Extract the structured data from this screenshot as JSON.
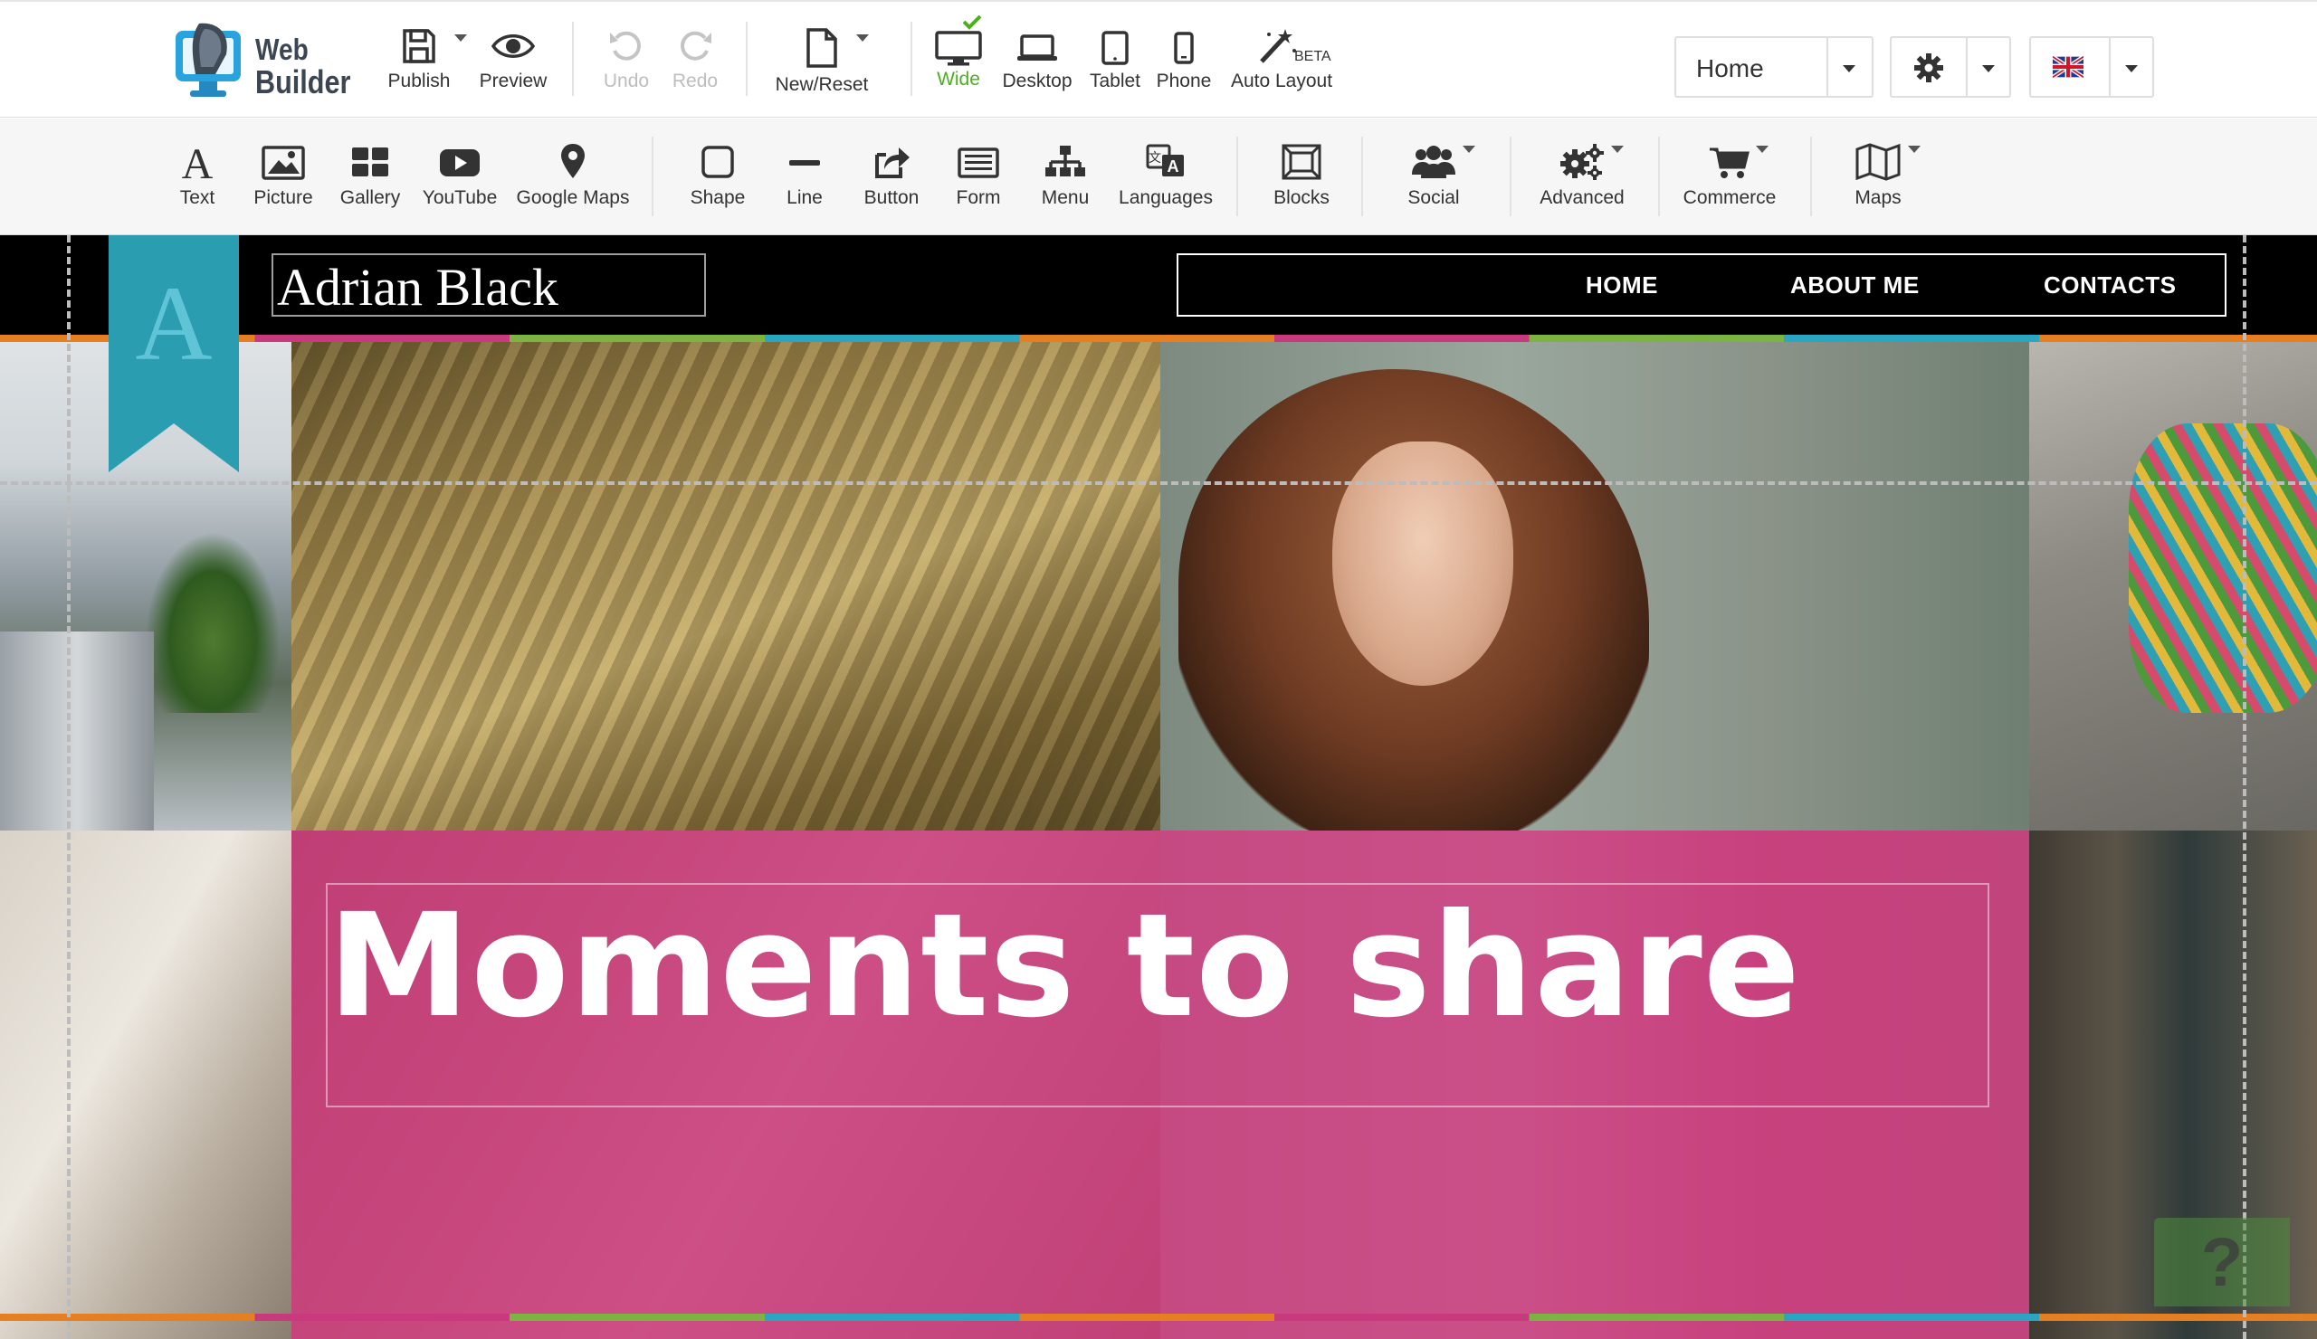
{
  "app": {
    "logo_line1": "Web",
    "logo_line2": "Builder"
  },
  "toolbar": {
    "publish": "Publish",
    "preview": "Preview",
    "undo": "Undo",
    "redo": "Redo",
    "new_reset": "New/Reset",
    "wide": "Wide",
    "desktop": "Desktop",
    "tablet": "Tablet",
    "phone": "Phone",
    "auto_layout": "Auto Layout",
    "beta": "BETA",
    "page_select": "Home"
  },
  "insert": {
    "text": "Text",
    "picture": "Picture",
    "gallery": "Gallery",
    "youtube": "YouTube",
    "google_maps": "Google Maps",
    "shape": "Shape",
    "line": "Line",
    "button": "Button",
    "form": "Form",
    "menu": "Menu",
    "languages": "Languages",
    "blocks": "Blocks",
    "social": "Social",
    "advanced": "Advanced",
    "commerce": "Commerce",
    "maps": "Maps"
  },
  "site": {
    "ribbon_letter": "A",
    "site_title": "Adrian Black",
    "nav": [
      "HOME",
      "ABOUT ME",
      "CONTACTS"
    ],
    "headline": "Moments to share",
    "help": "?"
  },
  "colors": {
    "active_green": "#4caf1e",
    "ribbon_teal": "#2a9db0",
    "overlay_magenta": "#c8397e",
    "header_black": "#000000"
  }
}
